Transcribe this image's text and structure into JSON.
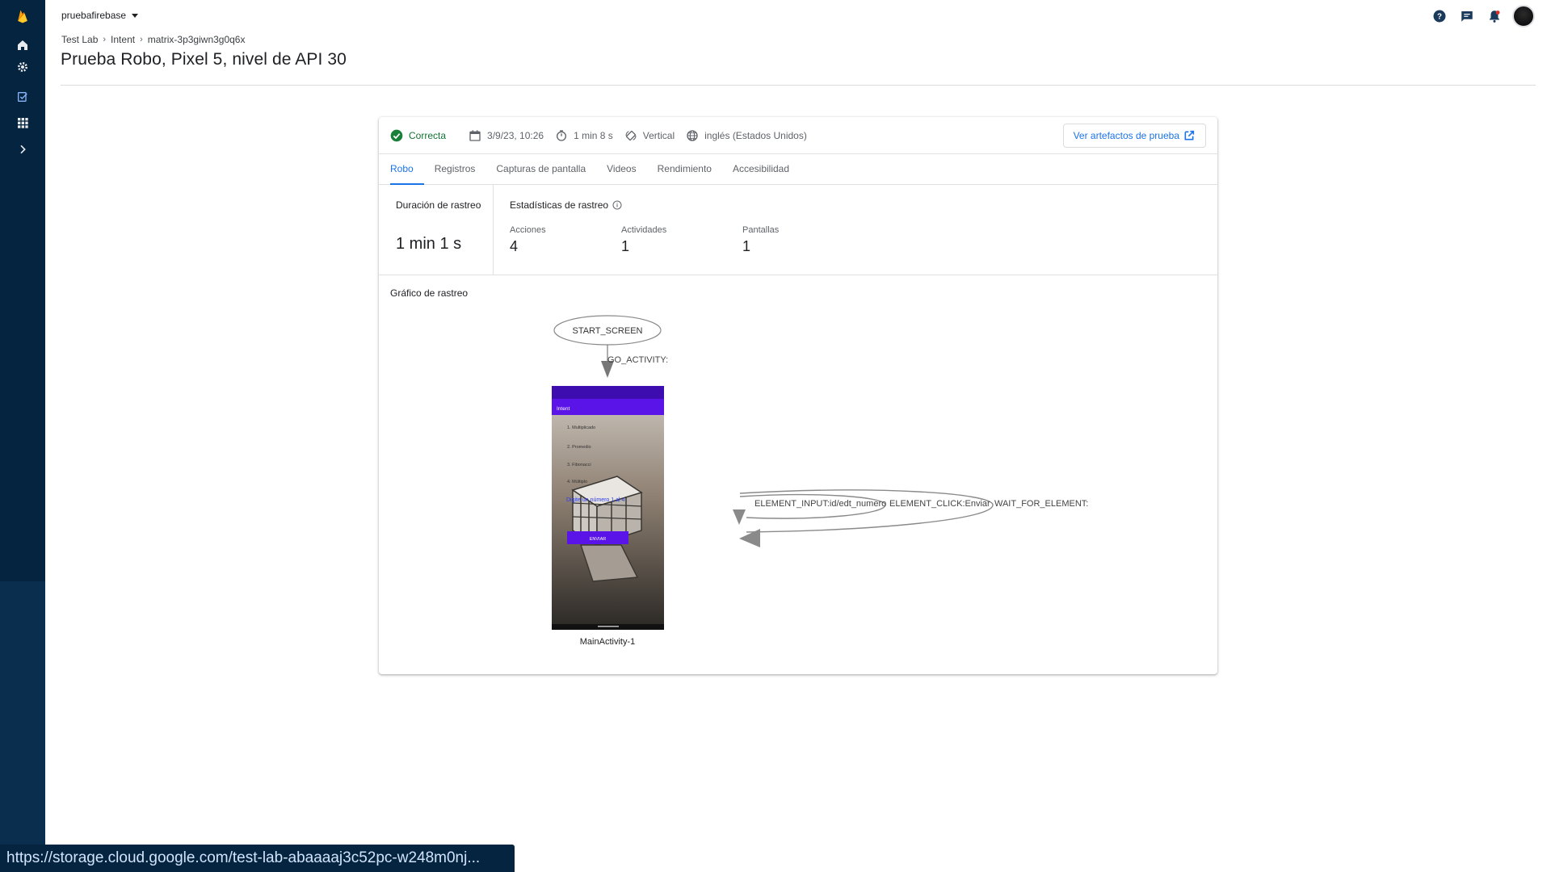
{
  "header": {
    "project": "pruebafirebase",
    "breadcrumb": [
      "Test Lab",
      "Intent",
      "matrix-3p3giwn3g0q6x"
    ],
    "title": "Prueba Robo, Pixel 5, nivel de API 30"
  },
  "summary": {
    "status": "Correcta",
    "date": "3/9/23, 10:26",
    "duration": "1 min 8 s",
    "orientation": "Vertical",
    "locale": "inglés (Estados Unidos)",
    "artifacts_label": "Ver artefactos de prueba"
  },
  "tabs": [
    "Robo",
    "Registros",
    "Capturas de pantalla",
    "Videos",
    "Rendimiento",
    "Accesibilidad"
  ],
  "stats": {
    "crawl_duration_label": "Duración de rastreo",
    "crawl_duration_value": "1 min 1 s",
    "crawl_stats_label": "Estadísticas de rastreo",
    "metrics": [
      {
        "label": "Acciones",
        "value": "4"
      },
      {
        "label": "Actividades",
        "value": "1"
      },
      {
        "label": "Pantallas",
        "value": "1"
      }
    ]
  },
  "graph": {
    "title": "Gráfico de rastreo",
    "start_node": "START_SCREEN",
    "edge_label": "GO_ACTIVITY:",
    "screen_label": "MainActivity-1",
    "loop_labels": [
      "ELEMENT_INPUT:id/edt_numero",
      "ELEMENT_CLICK:Enviar",
      "WAIT_FOR_ELEMENT:"
    ],
    "phone": {
      "app_bar": "Intent",
      "menu_items": [
        "1. Multiplicado",
        "2. Promedio",
        "3. Fibonacci",
        "4. Múltiplo"
      ],
      "input_hint": "Digite un número 1 al 4",
      "button": "ENVIAR"
    }
  },
  "status_url": "https://storage.cloud.google.com/test-lab-abaaaaj3c52pc-w248m0nj...",
  "colors": {
    "rail": "#04243f",
    "accent": "#1a73e8",
    "success": "#137333",
    "phone_primary": "#5a14e8"
  }
}
